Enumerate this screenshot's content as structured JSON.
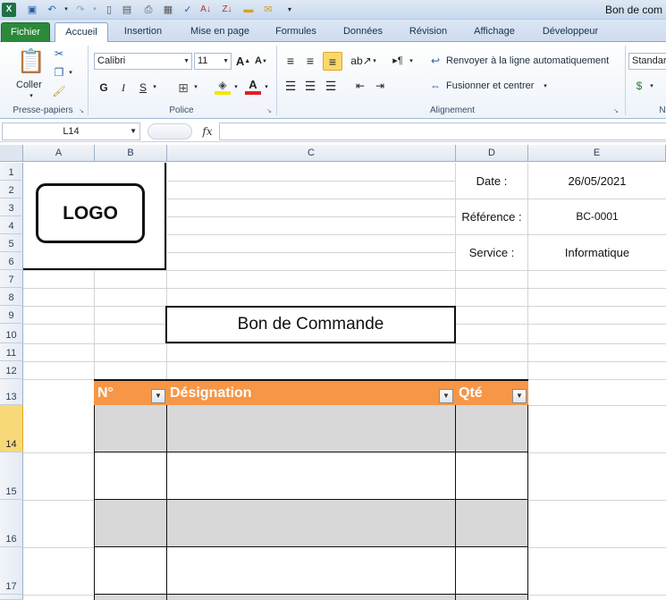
{
  "titlebar": {
    "title": "Bon de com",
    "quick_access": [
      "excel-icon",
      "save-icon",
      "undo-icon",
      "redo-icon",
      "new-icon",
      "open-icon",
      "print-icon",
      "print-preview-icon",
      "spellcheck-icon",
      "sort-asc-icon",
      "sort-desc-icon",
      "folder-icon",
      "email-icon",
      "customize-icon"
    ]
  },
  "tabs": [
    "Fichier",
    "Accueil",
    "Insertion",
    "Mise en page",
    "Formules",
    "Données",
    "Révision",
    "Affichage",
    "Développeur"
  ],
  "active_tab": "Accueil",
  "ribbon": {
    "clipboard": {
      "paste_label": "Coller",
      "group_label": "Presse-papiers"
    },
    "font": {
      "name": "Calibri",
      "size": "11",
      "group_label": "Police",
      "bold": "G",
      "italic": "I",
      "underline": "S"
    },
    "alignment": {
      "wrap_label": "Renvoyer à la ligne automatiquement",
      "merge_label": "Fusionner et centrer",
      "group_label": "Alignement"
    },
    "number": {
      "format": "Standar",
      "group_label": "N"
    }
  },
  "formula_bar": {
    "name_box": "L14",
    "fx": "fx",
    "formula": ""
  },
  "columns": [
    "A",
    "B",
    "C",
    "D",
    "E"
  ],
  "rows": [
    "1",
    "2",
    "3",
    "4",
    "5",
    "6",
    "7",
    "8",
    "9",
    "10",
    "11",
    "12",
    "13",
    "14",
    "15",
    "16",
    "17"
  ],
  "selected_row": "14",
  "sheet": {
    "logo_text": "LOGO",
    "date_label": "Date :",
    "date_value": "26/05/2021",
    "reference_label": "Référence :",
    "reference_value": "BC-0001",
    "service_label": "Service :",
    "service_value": "Informatique",
    "doc_title": "Bon de Commande",
    "table_headers": [
      "N°",
      "Désignation",
      "Qté"
    ]
  },
  "colors": {
    "header_orange": "#f79646",
    "row_gray": "#d8d8d8",
    "file_tab_green": "#2b8a3a",
    "selected_row": "#f8d97a"
  }
}
